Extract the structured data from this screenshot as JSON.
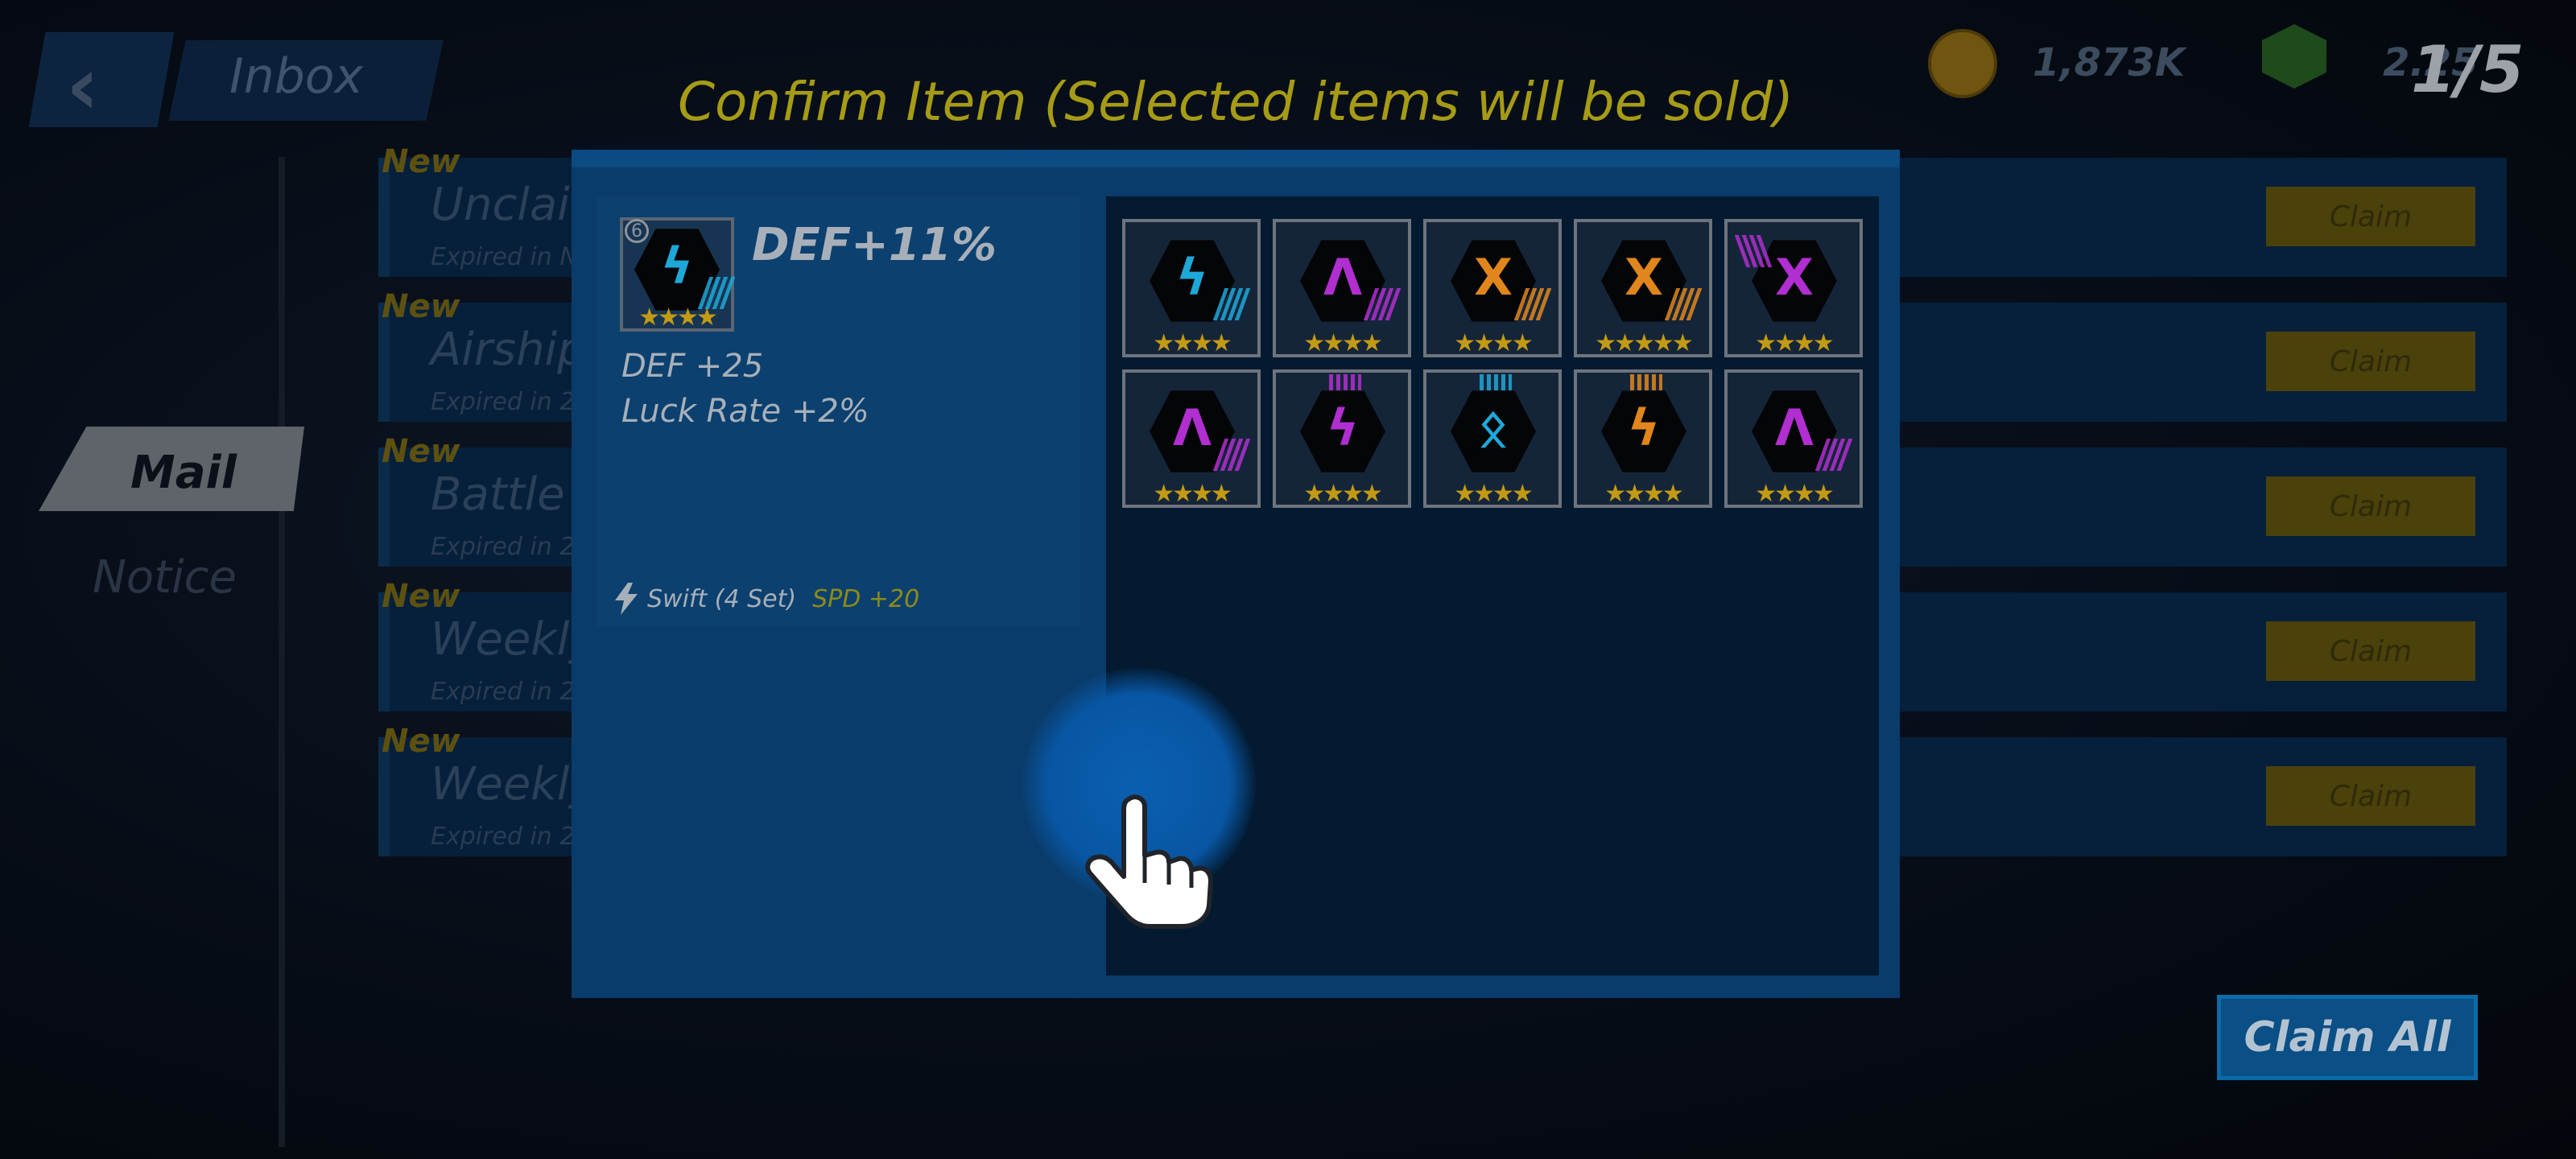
{
  "header": {
    "title": "Inbox",
    "coins": "1,873K",
    "gems": "2.25",
    "page_counter": "1/5"
  },
  "sidebar": {
    "tabs": [
      {
        "label": "Mail"
      },
      {
        "label": "Notice"
      }
    ]
  },
  "mail_rows": [
    {
      "badge": "New",
      "title": "Unclai",
      "expires": "Expired in N",
      "claim": "Claim"
    },
    {
      "badge": "New",
      "title": "Airship",
      "expires": "Expired in 2",
      "claim": "Claim"
    },
    {
      "badge": "New",
      "title": "Battle",
      "expires": "Expired in 2",
      "claim": "Claim"
    },
    {
      "badge": "New",
      "title": "Weekly",
      "expires": "Expired in 2",
      "claim": "Claim"
    },
    {
      "badge": "New",
      "title": "Weekly",
      "expires": "Expired in 2",
      "claim": "Claim"
    }
  ],
  "claim_all": "Claim All",
  "modal": {
    "title": "Confirm Item (Selected items will be sold)",
    "detail": {
      "level": "6",
      "name": "DEF+11%",
      "stats": [
        "DEF +25",
        "Luck Rate +2%"
      ],
      "set_name": "Swift (4 Set)",
      "set_bonus": "SPD +20",
      "stars": 4,
      "icon": "lightning-icon",
      "color": "#1ea8d8"
    },
    "items": [
      {
        "icon": "lightning-icon",
        "color": "#1ea8d8",
        "stars": 4
      },
      {
        "icon": "arrow-icon",
        "color": "#b12ed0",
        "stars": 4
      },
      {
        "icon": "cross-icon",
        "color": "#e0861c",
        "stars": 4
      },
      {
        "icon": "cross-icon",
        "color": "#e0861c",
        "stars": 5
      },
      {
        "icon": "cross-icon",
        "color": "#b12ed0",
        "stars": 4
      },
      {
        "icon": "arrow-icon",
        "color": "#b12ed0",
        "stars": 4
      },
      {
        "icon": "lightning-icon",
        "color": "#b12ed0",
        "stars": 4
      },
      {
        "icon": "rune-icon",
        "color": "#1ea8d8",
        "stars": 4
      },
      {
        "icon": "lightning-icon",
        "color": "#e0861c",
        "stars": 4
      },
      {
        "icon": "arrow-icon",
        "color": "#b12ed0",
        "stars": 4
      }
    ]
  }
}
